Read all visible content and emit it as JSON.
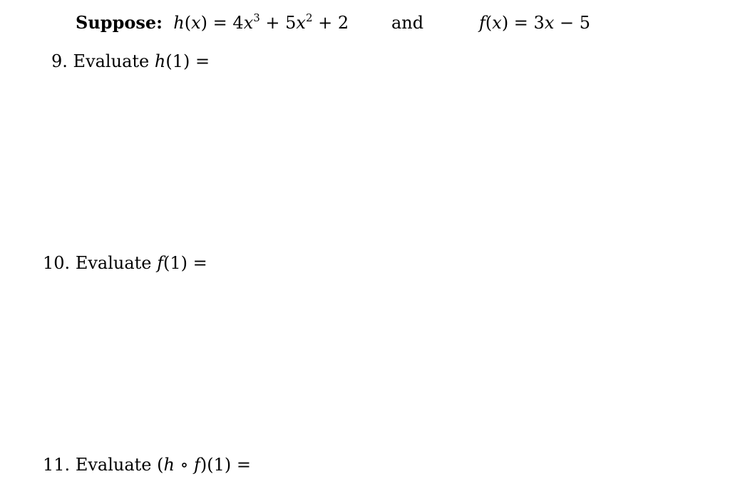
{
  "header": {
    "suppose_label": "Suppose:",
    "h_def": {
      "name": "h",
      "var": "x",
      "terms": [
        "4",
        "x",
        "3",
        " + 5",
        "x",
        "2",
        " + 2"
      ]
    },
    "connector": "and",
    "f_def": {
      "name": "f",
      "var": "x",
      "rhs_coef": "3",
      "rhs_var": "x",
      "rhs_rest": " − 5"
    }
  },
  "questions": [
    {
      "number": "9.",
      "label": "Evaluate",
      "expr_fn": "h",
      "expr_arg": "(1) ="
    },
    {
      "number": "10.",
      "label": "Evaluate",
      "expr_fn": "f",
      "expr_arg": "(1) ="
    },
    {
      "number": "11.",
      "label": "Evaluate",
      "expr_open": "(",
      "expr_h": "h",
      "expr_op": " ∘ ",
      "expr_f": "f",
      "expr_arg": ")(1) ="
    }
  ]
}
